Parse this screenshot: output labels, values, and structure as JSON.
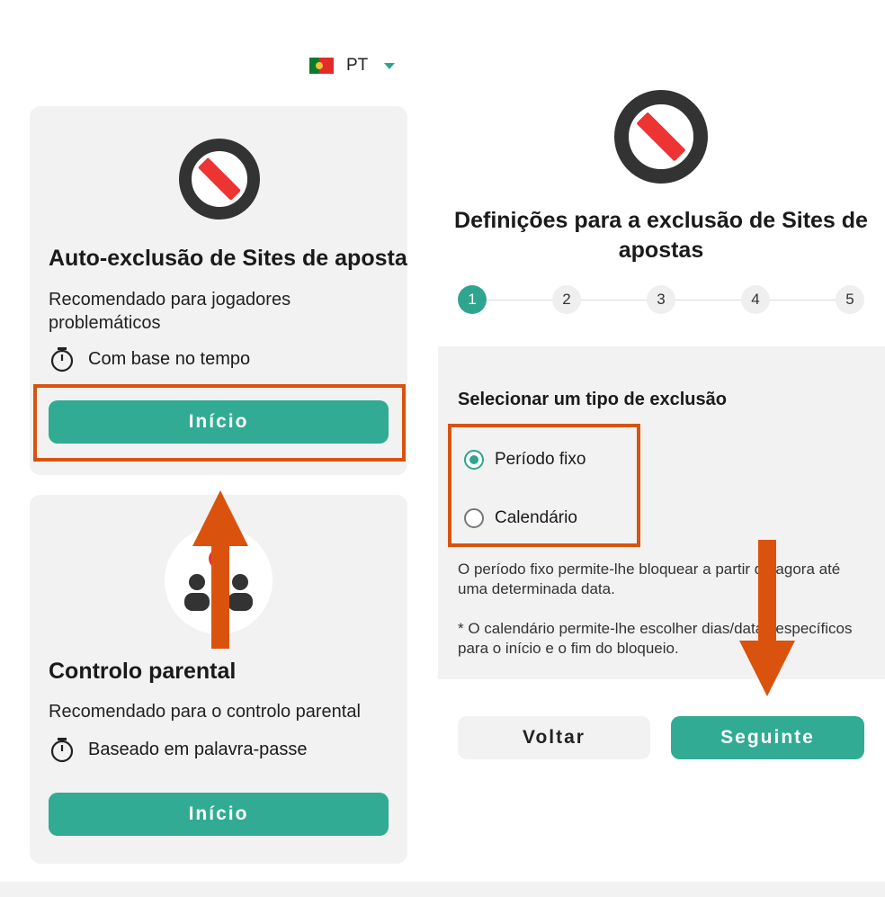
{
  "language": {
    "code": "PT",
    "flag_icon": "portugal-flag-icon"
  },
  "cards": [
    {
      "title": "Auto-exclusão de Sites de apostas",
      "description": "Recomendado para jogadores problemáticos",
      "meta": "Com base no tempo",
      "button": "Início"
    },
    {
      "title": "Controlo parental",
      "description": "Recomendado para o controlo parental",
      "meta": "Baseado em palavra-passe",
      "button": "Início"
    }
  ],
  "settings": {
    "title": "Definições para a exclusão de Sites de apostas",
    "steps": [
      "1",
      "2",
      "3",
      "4",
      "5"
    ],
    "active_step": 1,
    "section_title": "Selecionar um tipo de exclusão",
    "options": [
      {
        "label": "Período fixo",
        "checked": true
      },
      {
        "label": "Calendário",
        "checked": false
      }
    ],
    "info_fixed": "O período fixo permite-lhe bloquear a partir de agora até uma determinada data.",
    "info_calendar": "* O calendário permite-lhe escolher dias/datas específicos para o início e o fim do bloqueio.",
    "back_label": "Voltar",
    "next_label": "Seguinte"
  },
  "colors": {
    "accent": "#31ab93",
    "highlight": "#d9530f",
    "block_icon_ring": "#333333",
    "block_icon_bar": "#ee3333"
  }
}
